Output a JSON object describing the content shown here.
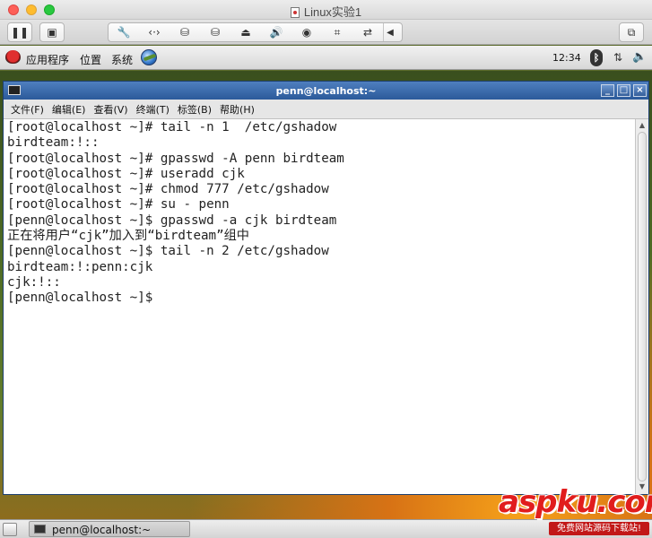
{
  "mac_window": {
    "title": "Linux实验1",
    "toolbar_icons": [
      "pause-icon",
      "snapshot-icon",
      "wrench-icon",
      "network-arrows-icon",
      "hdd-icon",
      "hdd-icon",
      "cdrom-icon",
      "sound-icon",
      "camera-icon",
      "usb-icon",
      "share-icon",
      "collapse-arrow-icon",
      "fullscreen-icon"
    ]
  },
  "gnome_panel": {
    "menus": [
      "应用程序",
      "位置",
      "系统"
    ],
    "clock": "12:34"
  },
  "terminal": {
    "title": "penn@localhost:~",
    "menu": [
      "文件(F)",
      "编辑(E)",
      "查看(V)",
      "终端(T)",
      "标签(B)",
      "帮助(H)"
    ],
    "lines": [
      "[root@localhost ~]# tail -n 1  /etc/gshadow",
      "birdteam:!::",
      "[root@localhost ~]# gpasswd -A penn birdteam",
      "[root@localhost ~]# useradd cjk",
      "[root@localhost ~]# chmod 777 /etc/gshadow",
      "[root@localhost ~]# su - penn",
      "[penn@localhost ~]$ gpasswd -a cjk birdteam",
      "正在将用户“cjk”加入到“birdteam”组中",
      "[penn@localhost ~]$ tail -n 2 /etc/gshadow",
      "birdteam:!:penn:cjk",
      "cjk:!::",
      "[penn@localhost ~]$ "
    ]
  },
  "taskbar": {
    "task_label": "penn@localhost:~"
  },
  "watermark": {
    "logo": "aspku.com",
    "subtitle": "免费网站源码下载站!"
  }
}
